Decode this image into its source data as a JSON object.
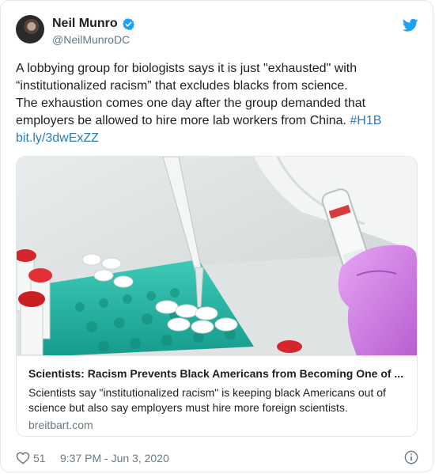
{
  "tweet": {
    "author": {
      "name": "Neil Munro",
      "handle": "@NeilMunroDC",
      "verified": true
    },
    "text_lines": [
      "A lobbying group for biologists says it is just \"exhausted\" with",
      "“institutionalized racism” that excludes blacks from science.",
      "The exhaustion comes one day after the group demanded that",
      "employers be allowed to hire more lab workers from China."
    ],
    "hashtag": "#H1B",
    "short_link": "bit.ly/3dwExZZ",
    "card": {
      "title": "Scientists: Racism Prevents Black Americans from Becoming One of ...",
      "description": "Scientists say \"institutionalized racism\" is keeping black Americans out of science but also say employers must hire more foreign scientists.",
      "domain": "breitbart.com",
      "image_icon": "lab-photo"
    },
    "likes": "51",
    "timestamp": "9:37 PM - Jun 3, 2020"
  },
  "colors": {
    "link": "#2b7bb9",
    "twitter_blue": "#1da1f2",
    "muted": "#697882",
    "border": "#e1e8ed"
  },
  "icons": {
    "verified": "verified-badge-icon",
    "brand": "twitter-bird-icon",
    "like": "heart-icon",
    "info": "info-icon"
  }
}
